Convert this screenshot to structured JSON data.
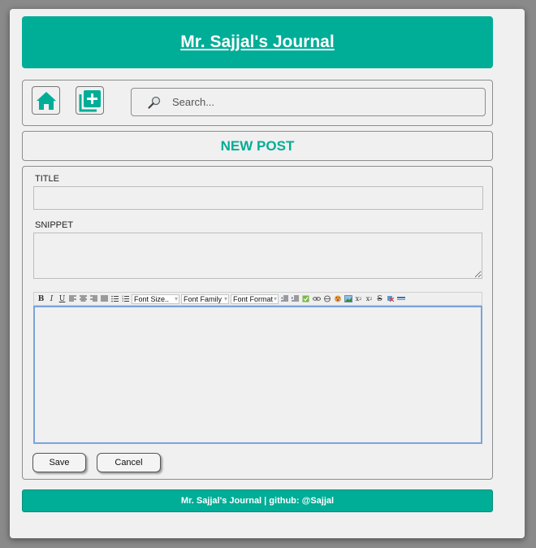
{
  "app": {
    "title": "Mr. Sajjal's Journal",
    "accent_color": "#00ad97"
  },
  "nav": {
    "home_icon": "home-icon",
    "add_icon": "add-post-icon"
  },
  "search": {
    "placeholder": "Search...",
    "value": "",
    "icon": "magnifier-icon"
  },
  "page": {
    "heading": "NEW POST"
  },
  "form": {
    "title_label": "TITLE",
    "title_value": "",
    "snippet_label": "SNIPPET",
    "snippet_value": "",
    "editor": {
      "buttons": [
        "B",
        "I",
        "U"
      ],
      "font_size": "Font Size..",
      "font_family": "Font Family",
      "font_format": "Font Format",
      "content": ""
    },
    "save_label": "Save",
    "cancel_label": "Cancel"
  },
  "footer": {
    "text": "Mr. Sajjal's Journal | github: @Sajjal"
  }
}
